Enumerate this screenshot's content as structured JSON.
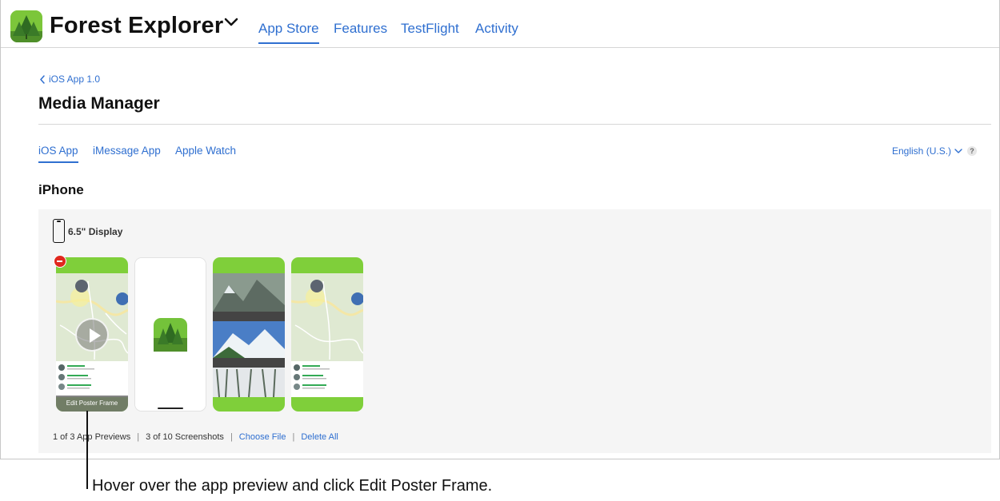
{
  "header": {
    "app_name": "Forest Explorer",
    "tabs": [
      {
        "label": "App Store",
        "active": true
      },
      {
        "label": "Features",
        "active": false
      },
      {
        "label": "TestFlight",
        "active": false
      },
      {
        "label": "Activity",
        "active": false
      }
    ]
  },
  "breadcrumb": {
    "back_label": "iOS App 1.0"
  },
  "page": {
    "title": "Media Manager"
  },
  "sub_tabs": [
    {
      "label": "iOS App",
      "active": true
    },
    {
      "label": "iMessage App",
      "active": false
    },
    {
      "label": "Apple Watch",
      "active": false
    }
  ],
  "language": {
    "selected": "English (U.S.)",
    "help_glyph": "?"
  },
  "section": {
    "title": "iPhone"
  },
  "display": {
    "label": "6.5\" Display"
  },
  "preview": {
    "poster_label": "Edit Poster Frame"
  },
  "status": {
    "previews": "1 of 3 App Previews",
    "screenshots": "3 of 10 Screenshots",
    "choose_file": "Choose File",
    "delete_all": "Delete All",
    "separator": "|"
  },
  "caption": "Hover over the app preview and click Edit Poster Frame.",
  "colors": {
    "accent": "#2f6fd0",
    "brand_green": "#7fcf3a",
    "delete_red": "#e0281e"
  }
}
